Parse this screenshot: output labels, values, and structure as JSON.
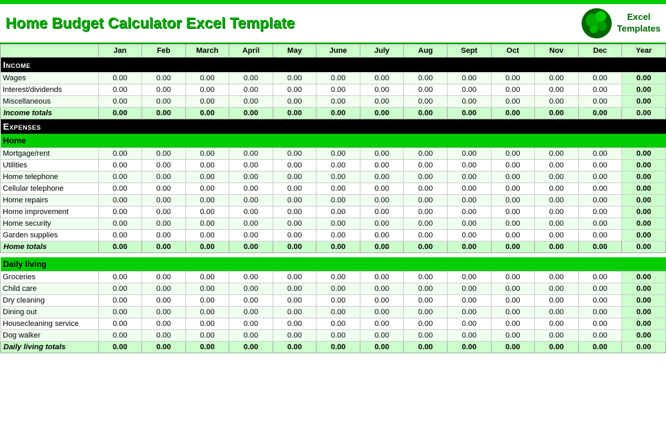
{
  "header": {
    "title": "Home Budget Calculator Excel Template",
    "logo_line1": "Excel",
    "logo_line2": "Templates"
  },
  "months": [
    "Jan",
    "Feb",
    "March",
    "April",
    "May",
    "June",
    "July",
    "Aug",
    "Sept",
    "Oct",
    "Nov",
    "Dec",
    "Year"
  ],
  "sections": {
    "income": {
      "label": "Income",
      "rows": [
        {
          "label": "Wages"
        },
        {
          "label": "Interest/dividends"
        },
        {
          "label": "Miscellaneous"
        }
      ],
      "totals_label": "Income totals"
    },
    "expenses": {
      "label": "Expenses"
    },
    "home": {
      "label": "Home",
      "rows": [
        {
          "label": "Mortgage/rent"
        },
        {
          "label": "Utilities"
        },
        {
          "label": "Home telephone"
        },
        {
          "label": "Cellular telephone"
        },
        {
          "label": "Home repairs"
        },
        {
          "label": "Home improvement"
        },
        {
          "label": "Home security"
        },
        {
          "label": "Garden supplies"
        }
      ],
      "totals_label": "Home totals"
    },
    "daily_living": {
      "label": "Daily living",
      "rows": [
        {
          "label": "Groceries"
        },
        {
          "label": "Child care"
        },
        {
          "label": "Dry cleaning"
        },
        {
          "label": "Dining out"
        },
        {
          "label": "Housecleaning service"
        },
        {
          "label": "Dog walker"
        }
      ],
      "totals_label": "Daily living totals"
    }
  },
  "default_value": "0.00",
  "default_total": "0.00"
}
